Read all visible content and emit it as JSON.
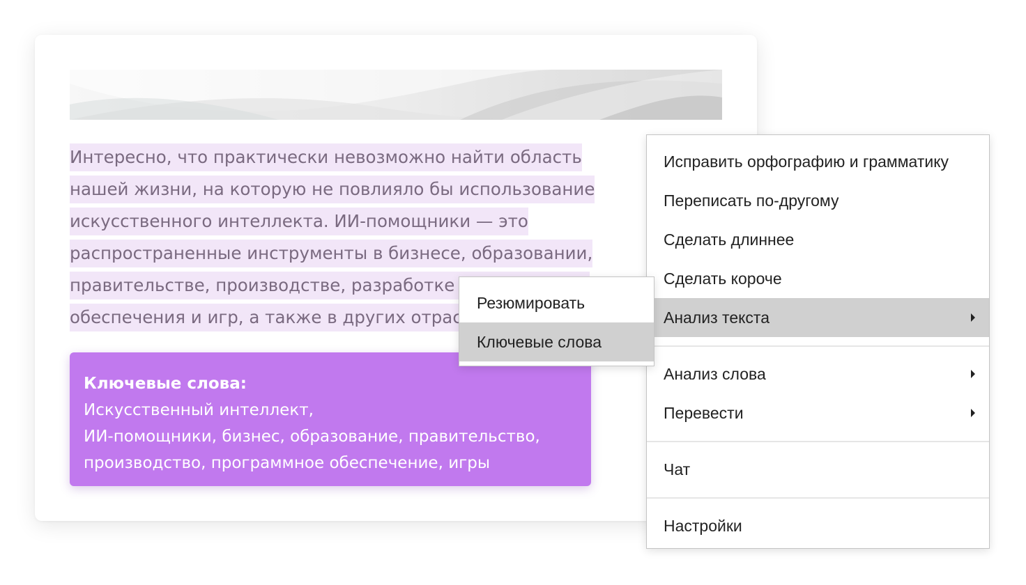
{
  "document": {
    "paragraph_lines": [
      "Интересно, что практически невозможно найти область",
      "нашей жизни, на которую не повлияло бы использование",
      "искусственного интеллекта. ИИ-помощники — это",
      "распространенные инструменты в бизнесе, образовании,",
      "правительстве, производстве, разработке программного",
      "обеспечения и игр, а также в других отраслях."
    ]
  },
  "keywords_result": {
    "title": "Ключевые слова:",
    "lines": [
      "Искусственный интеллект,",
      "ИИ-помощники, бизнес, образование, правительство,",
      "производство, программное обеспечение, игры"
    ]
  },
  "context_menu": {
    "items": [
      {
        "label": "Исправить орфографию и грамматику",
        "submenu": false
      },
      {
        "label": "Переписать по-другому",
        "submenu": false
      },
      {
        "label": "Сделать длиннее",
        "submenu": false
      },
      {
        "label": "Сделать короче",
        "submenu": false
      },
      {
        "label": "Анализ текста",
        "submenu": true,
        "active": true
      },
      {
        "label": "Анализ слова",
        "submenu": true
      },
      {
        "label": "Перевести",
        "submenu": true
      },
      {
        "label": "Чат",
        "submenu": false
      },
      {
        "label": "Настройки",
        "submenu": false
      }
    ]
  },
  "submenu": {
    "items": [
      {
        "label": "Резюмировать"
      },
      {
        "label": "Ключевые слова",
        "active": true
      }
    ]
  },
  "colors": {
    "highlight": "#f2e6f8",
    "keywords_background": "#c179ee",
    "menu_active": "#d0d0d0"
  }
}
